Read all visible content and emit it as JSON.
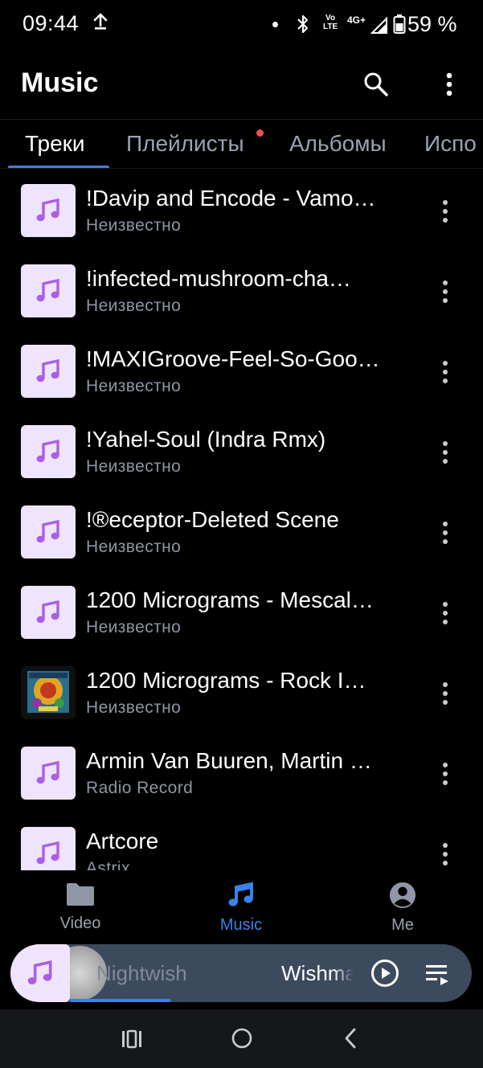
{
  "status_bar": {
    "time": "09:44",
    "volte_line1": "Vo",
    "volte_line2": "LTE",
    "network": "4G+",
    "battery_percent": "59 %",
    "battery_level": 0.59
  },
  "app_bar": {
    "title": "Music",
    "icons": [
      "search-icon",
      "more-vert-icon"
    ]
  },
  "tabs": [
    {
      "label": "Треки",
      "active": true
    },
    {
      "label": "Плейлисты",
      "active": false,
      "badge_dot": true
    },
    {
      "label": "Альбомы",
      "active": false
    },
    {
      "label": "Испо",
      "active": false
    }
  ],
  "tracks": [
    {
      "title": "!Davip and Encode - Vamo…",
      "artist": "Неизвестно",
      "art": "music-note"
    },
    {
      "title": "!infected-mushroom-cha…",
      "artist": "Неизвестно",
      "art": "music-note"
    },
    {
      "title": "!MAXIGroove-Feel-So-Goo…",
      "artist": "Неизвестно",
      "art": "music-note"
    },
    {
      "title": "!Yahel-Soul (Indra Rmx)",
      "artist": "Неизвестно",
      "art": "music-note"
    },
    {
      "title": "!®eceptor-Deleted Scene",
      "artist": "Неизвестно",
      "art": "music-note"
    },
    {
      "title": "1200 Micrograms - Mescal…",
      "artist": "Неизвестно",
      "art": "music-note"
    },
    {
      "title": "1200 Micrograms - Rock I…",
      "artist": "Неизвестно",
      "art": "album-cover"
    },
    {
      "title": "Armin Van Buuren, Martin …",
      "artist": "Radio Record",
      "art": "music-note"
    },
    {
      "title": "Artcore",
      "artist": "Astrix",
      "art": "music-note"
    }
  ],
  "bottom_nav": [
    {
      "label": "Video",
      "icon": "folder-icon",
      "active": false
    },
    {
      "label": "Music",
      "icon": "music-note-icon",
      "active": true
    },
    {
      "label": "Me",
      "icon": "account-icon",
      "active": false
    }
  ],
  "mini_player": {
    "artist": "Nightwish",
    "song": "Wishmaster",
    "progress": 0.3
  },
  "colors": {
    "accent": "#3a82e6",
    "thumb_bg": "#efe4fd",
    "note": "#a95fe6",
    "badge": "#f04e55",
    "player_bg": "#3c4a5e"
  }
}
